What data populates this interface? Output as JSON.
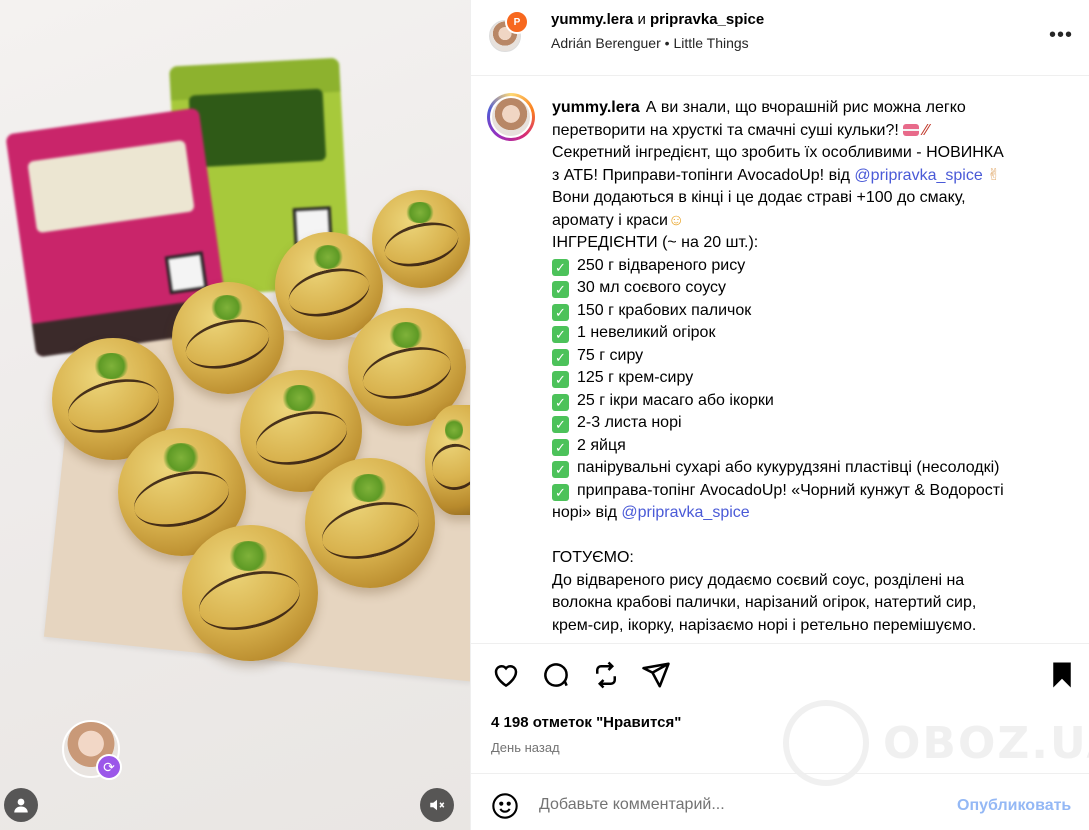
{
  "header": {
    "author": "yummy.lera",
    "joiner": "и",
    "collaborator": "pripravka_spice",
    "audio_artist": "Adrián Berenguer",
    "audio_separator": "•",
    "audio_track": "Little Things",
    "more_glyph": "•••"
  },
  "caption": {
    "username": "yummy.lera",
    "lines": [
      "А ви знали, що вчорашній рис можна легко",
      "перетворити на хрусткі та смачні суші кульки?!",
      "Секретний інгредієнт, що зробить їх особливими - НОВИНКА",
      "з АТБ! Приправи-топінги AvocadoUp! від",
      "@pripravka_spice",
      "Вони додаються в кінці і це додає страві +100 до смаку,",
      "аромату і краси",
      "ІНГРЕДІЄНТИ (~ на 20 шт.):"
    ],
    "ingredients": [
      "250 г відвареного рису",
      "30 мл соєвого соусу",
      "150 г крабових паличок",
      "1 невеликий огірок",
      "75 г сиру",
      "125 г крем-сиру",
      "25 г ікри масаго або ікорки",
      "2-3 листа норі",
      "2 яйця",
      "панірувальні сухарі або кукурудзяні пластівці (несолодкі)",
      "приправа-топінг AvocadoUp! «Чорний кунжут & Водорості"
    ],
    "ingredient_tail": "норі» від",
    "ingredient_tail_mention": "@pripravka_spice",
    "steps_title": "ГОТУЄМО:",
    "steps": [
      "До відвареного рису додаємо соєвий соус, розділені на",
      "волокна крабові палички, нарізаний огірок, натертий сир,",
      "крем-сир, ікорку, нарізаємо норі і ретельно перемішуємо."
    ]
  },
  "actions": {
    "likes": "4 198 отметок \"Нравится\"",
    "time": "День назад"
  },
  "comment": {
    "placeholder": "Добавьте комментарий...",
    "publish": "Опубликовать"
  },
  "watermark": {
    "text": "OBOZ.UA"
  },
  "colors": {
    "mention": "#4a5ad7",
    "publish": "#94b8f5",
    "check": "#4cc25a"
  }
}
